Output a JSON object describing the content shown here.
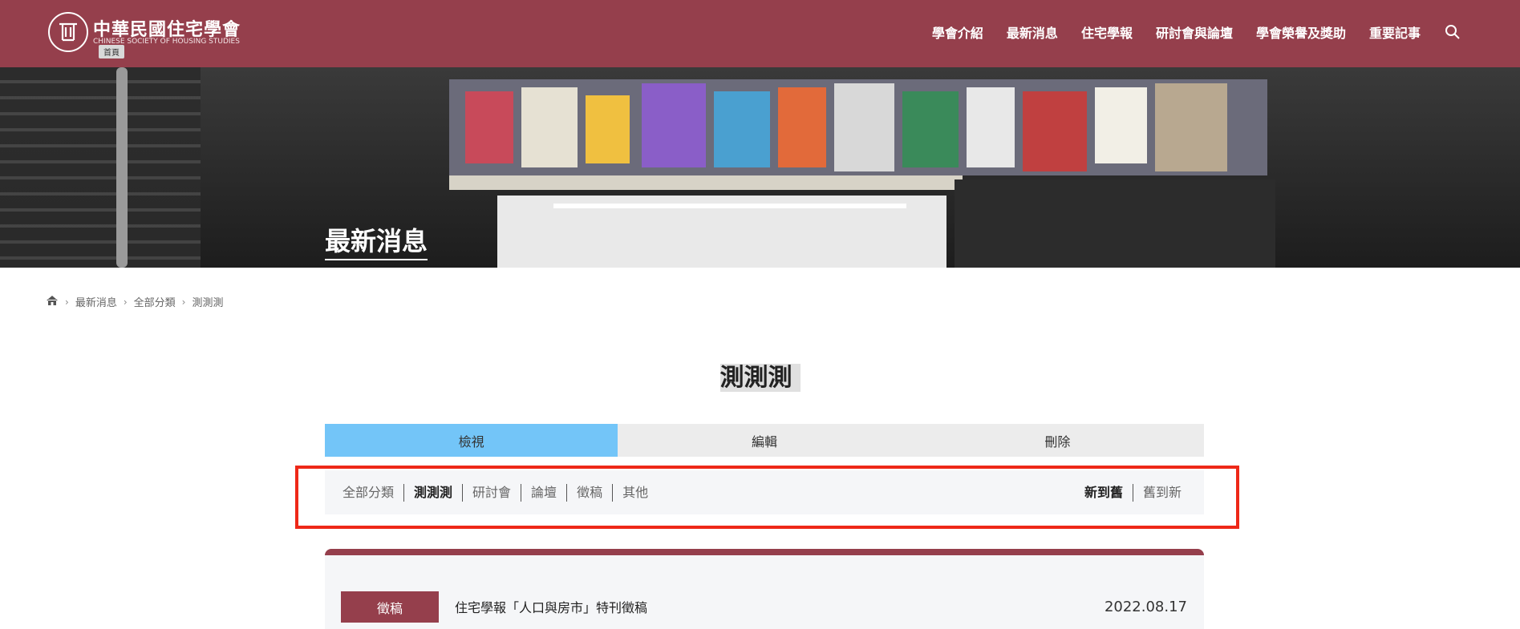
{
  "header": {
    "logo_title": "中華民國住宅學會",
    "logo_subtitle": "CHINESE SOCIETY OF HOUSING STUDIES",
    "home_tooltip": "首頁",
    "nav": [
      "學會介紹",
      "最新消息",
      "住宅學報",
      "研討會與論壇",
      "學會榮譽及獎助",
      "重要記事"
    ],
    "brand_color": "#953f4c"
  },
  "hero": {
    "title": "最新消息"
  },
  "breadcrumb": [
    "最新消息",
    "全部分類",
    "測測測"
  ],
  "page_title": "測測測",
  "tabs": [
    "檢視",
    "編輯",
    "刪除"
  ],
  "filters": {
    "categories": [
      "全部分類",
      "測測測",
      "研討會",
      "論壇",
      "徵稿",
      "其他"
    ],
    "sorts": [
      "新到舊",
      "舊到新"
    ]
  },
  "list": [
    {
      "badge": "徵稿",
      "title": "住宅學報「人口與房市」特刊徵稿",
      "date": "2022.08.17"
    }
  ]
}
